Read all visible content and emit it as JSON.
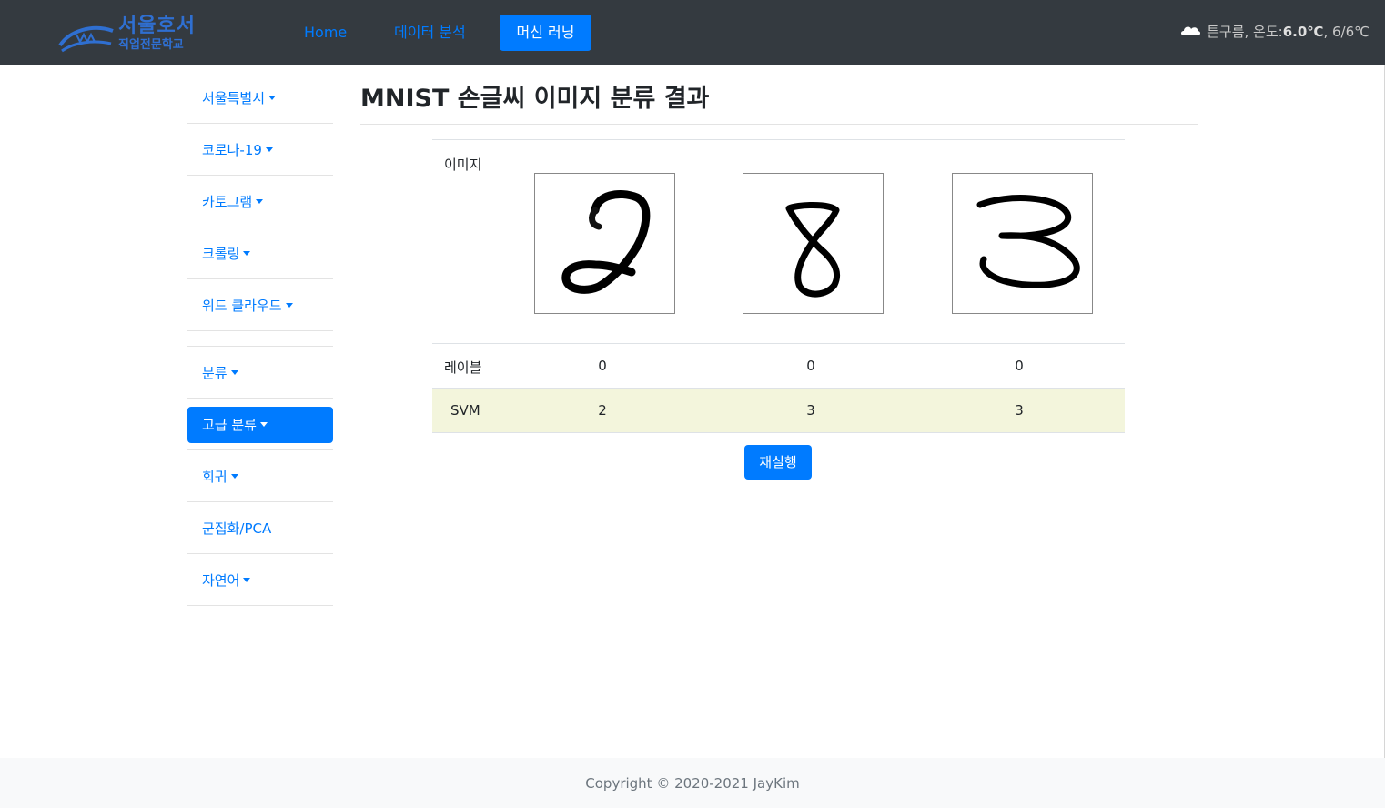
{
  "brand": {
    "line1": "서울호서",
    "line2": "직업전문학교"
  },
  "navbar": {
    "home": "Home",
    "data_analysis": "데이터 분석",
    "machine_learning": "머신 러닝",
    "weather": {
      "icon": "cloud-icon",
      "desc": "튼구름, 온도: ",
      "temp": "6.0℃",
      "range": ", 6/6℃"
    }
  },
  "sidebar": {
    "items": [
      {
        "label": "서울특별시",
        "dropdown": true
      },
      {
        "label": "코로나-19",
        "dropdown": true
      },
      {
        "label": "카토그램",
        "dropdown": true
      },
      {
        "label": "크롤링",
        "dropdown": true
      },
      {
        "label": "워드 클라우드",
        "dropdown": true
      },
      {
        "label": "분류",
        "dropdown": true
      },
      {
        "label": "고급 분류",
        "dropdown": true,
        "active": true
      },
      {
        "label": "회귀",
        "dropdown": true
      },
      {
        "label": "군집화/PCA",
        "dropdown": false
      },
      {
        "label": "자연어",
        "dropdown": true
      }
    ]
  },
  "main": {
    "title": "MNIST 손글씨 이미지 분류 결과",
    "table": {
      "image_label": "이미지",
      "digit_images": [
        "handwritten-digit-2",
        "handwritten-digit-8",
        "handwritten-digit-3"
      ],
      "label_row": {
        "label": "레이블",
        "values": [
          "0",
          "0",
          "0"
        ]
      },
      "svm_row": {
        "label": "SVM",
        "values": [
          "2",
          "3",
          "3"
        ]
      }
    },
    "rerun_button": "재실행"
  },
  "footer": {
    "copyright": "Copyright © 2020-2021 JayKim"
  },
  "colors": {
    "navbar": "#343a40",
    "accent": "#007bff",
    "svm_row": "#f3f5dc",
    "footer": "#f8f9fa"
  }
}
